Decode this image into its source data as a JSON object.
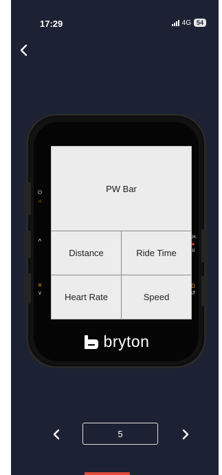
{
  "status_bar": {
    "time": "17:29",
    "network": "4G",
    "battery": "54"
  },
  "icons": {
    "back": "chevron-left-icon",
    "power": "power-icon",
    "light": "sun-icon",
    "up": "chevron-up-icon",
    "menu": "menu-icon",
    "down": "chevron-down-icon",
    "ok": "ok-icon",
    "pause": "pause-icon",
    "lap": "lap-icon",
    "back_device": "return-icon",
    "prev": "chevron-left-icon",
    "next": "chevron-right-icon"
  },
  "device": {
    "screen": {
      "top_field": "PW Bar",
      "fields": [
        "Distance",
        "Ride Time",
        "Heart Rate",
        "Speed"
      ]
    },
    "side_labels": {
      "ok": "OK"
    },
    "brand": "bryton"
  },
  "pager": {
    "page": "5"
  },
  "colors": {
    "background": "#1c2233",
    "device_body": "#121212",
    "lcd": "#ececec",
    "accent_orange": "#f39a1e",
    "accent_red": "#e24a3b"
  }
}
